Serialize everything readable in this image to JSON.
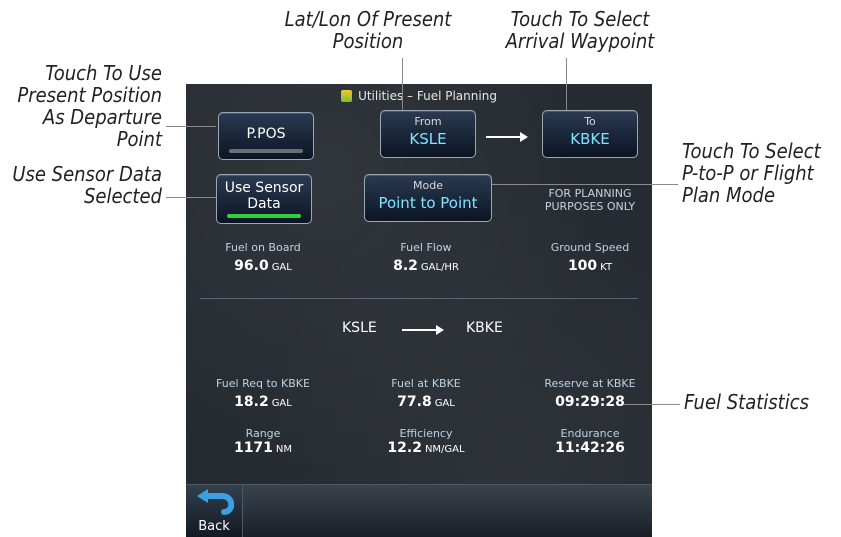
{
  "callouts": {
    "present_position": [
      "Touch To Use",
      "Present Position",
      "As Departure",
      "Point"
    ],
    "sensor_data": [
      "Use Sensor Data",
      "Selected"
    ],
    "lat_lon": [
      "Lat/Lon Of Present",
      "Position"
    ],
    "arrival": [
      "Touch To Select",
      "Arrival Waypoint"
    ],
    "mode": [
      "Touch To Select",
      "P-to-P or Flight",
      "Plan Mode"
    ],
    "fuel_statistics": "Fuel Statistics"
  },
  "screen": {
    "title": "Utilities – Fuel Planning",
    "ppos_label": "P.POS",
    "from_label": "From",
    "from_value": "KSLE",
    "to_label": "To",
    "to_value": "KBKE",
    "sensor_label_1": "Use Sensor",
    "sensor_label_2": "Data",
    "mode_label": "Mode",
    "mode_value": "Point to Point",
    "planning_1": "FOR PLANNING",
    "planning_2": "PURPOSES ONLY",
    "inputs": {
      "fuel_on_board": {
        "label": "Fuel on Board",
        "value": "96.0",
        "unit": "GAL"
      },
      "fuel_flow": {
        "label": "Fuel Flow",
        "value": "8.2",
        "unit": "GAL/HR"
      },
      "ground_speed": {
        "label": "Ground Speed",
        "value": "100",
        "unit": "KT"
      }
    },
    "route": {
      "from": "KSLE",
      "to": "KBKE"
    },
    "stats": {
      "fuel_req": {
        "label": "Fuel Req to KBKE",
        "value": "18.2",
        "unit": "GAL"
      },
      "fuel_at": {
        "label": "Fuel at KBKE",
        "value": "77.8",
        "unit": "GAL"
      },
      "reserve": {
        "label": "Reserve at KBKE",
        "value": "09:29:28",
        "unit": ""
      },
      "range": {
        "label": "Range",
        "value": "1171",
        "unit": "NM"
      },
      "efficiency": {
        "label": "Efficiency",
        "value": "12.2",
        "unit": "NM/GAL"
      },
      "endurance": {
        "label": "Endurance",
        "value": "11:42:26",
        "unit": ""
      }
    },
    "back_label": "Back",
    "colors": {
      "sensor_indicator": "#2fd13a",
      "ppos_indicator": "#6b6f75",
      "value_cyan": "#7fe3ff"
    }
  }
}
